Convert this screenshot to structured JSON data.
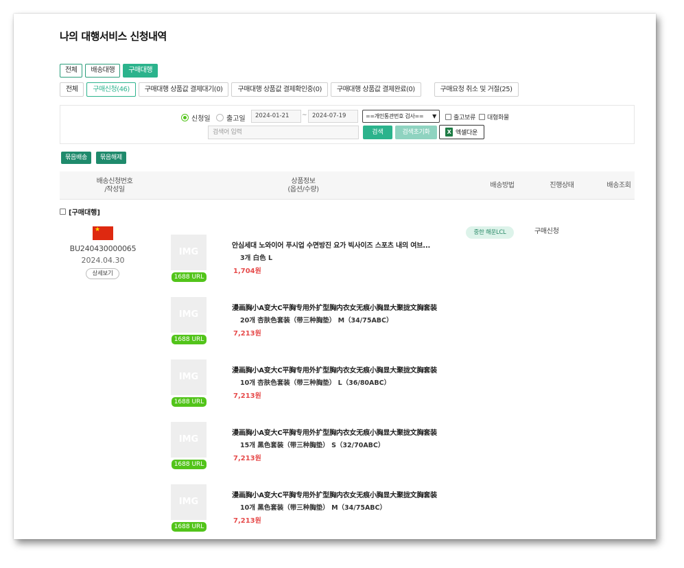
{
  "page": {
    "title": "나의 대행서비스 신청내역"
  },
  "service_tabs": [
    {
      "label": "전체",
      "active": false
    },
    {
      "label": "배송대행",
      "active": false
    },
    {
      "label": "구매대행",
      "active": true
    }
  ],
  "status_tabs": [
    {
      "label": "전체",
      "active": false
    },
    {
      "label": "구매신청(46)",
      "active": true
    },
    {
      "label": "구매대행 상품값 결제대기(0)",
      "active": false
    },
    {
      "label": "구매대행 상품값 결제확인중(0)",
      "active": false
    },
    {
      "label": "구매대행 상품값 결제완료(0)",
      "active": false
    },
    {
      "label": "구매요청 취소 및 거절(25)",
      "active": false
    }
  ],
  "filter": {
    "radio_apply": "신청일",
    "radio_release": "출고일",
    "date_from": "2024-01-21",
    "date_tilde": "~",
    "date_to": "2024-07-19",
    "select_value": "==개인통관번호 검사==",
    "check_hold": "출고보류",
    "check_bulk": "대형화물",
    "search_placeholder": "검색어 입력",
    "search_button": "검색",
    "reset_button": "검색초기화",
    "excel_button": "엑셀다운",
    "excel_icon": "X"
  },
  "bundle_buttons": {
    "bundle": "묶음배송",
    "unbundle": "묶음해제"
  },
  "table_header": {
    "order_no_line1": "배송신청번호",
    "order_no_line2": "/작성일",
    "product_line1": "상품정보",
    "product_line2": "(옵션/수량)",
    "shipping_method": "배송방법",
    "progress": "진행상태",
    "tracking": "배송조회"
  },
  "group": {
    "label": "[구매대행]"
  },
  "order": {
    "number": "BU240430000065",
    "date": "2024.04.30",
    "detail_button": "상세보기",
    "flag_icon": "china-flag-icon",
    "shipping_method": "중한 해운LCL",
    "status": "구매신청"
  },
  "items": [
    {
      "thumb": "IMG",
      "url_badge": "1688 URL",
      "name": "안심세대 노와이어 푸시업 수면방진 요가 빅사이즈 스포츠 내의 여브...",
      "option": "3개   白色   L",
      "price": "1,704원"
    },
    {
      "thumb": "IMG",
      "url_badge": "1688 URL",
      "name": "漫画胸小A变大C平胸专用外扩型胸内衣女无痕小胸显大聚拢文胸套装",
      "option": "20개   杏肤色套装（带三种胸垫）   M（34/75ABC）",
      "price": "7,213원"
    },
    {
      "thumb": "IMG",
      "url_badge": "1688 URL",
      "name": "漫画胸小A变大C平胸专用外扩型胸内衣女无痕小胸显大聚拢文胸套装",
      "option": "10개   杏肤色套装（带三种胸垫）   L（36/80ABC）",
      "price": "7,213원"
    },
    {
      "thumb": "IMG",
      "url_badge": "1688 URL",
      "name": "漫画胸小A变大C平胸专用外扩型胸内衣女无痕小胸显大聚拢文胸套装",
      "option": "15개   黑色套装（带三种胸垫）   S（32/70ABC）",
      "price": "7,213원"
    },
    {
      "thumb": "IMG",
      "url_badge": "1688 URL",
      "name": "漫画胸小A变大C平胸专用外扩型胸内衣女无痕小胸显大聚拢文胸套装",
      "option": "10개   黑色套装（带三种胸垫）   M（34/75ABC）",
      "price": "7,213원"
    }
  ],
  "colors": {
    "accent": "#2bb38c",
    "dark_accent": "#1f8a6c",
    "price": "#e64a4a",
    "url_badge": "#52c41a"
  }
}
